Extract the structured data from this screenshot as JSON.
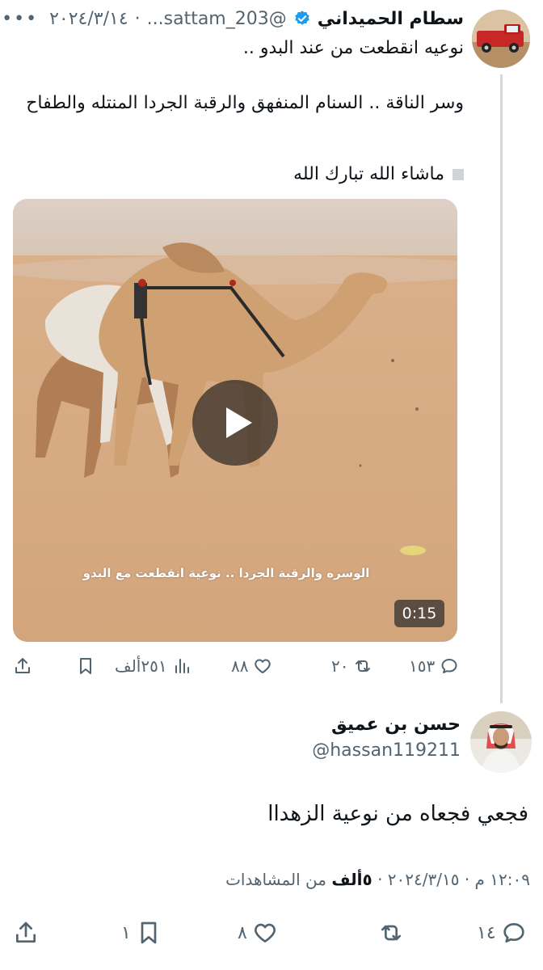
{
  "quoted_tweet": {
    "author_name": "سطام الحميداني",
    "handle": "@sattam_203...",
    "date": "٢٠٢٤/٣/١٤",
    "more_label": "•••",
    "line1": "نوعيه انقطعت من عند البدو ..",
    "line2": "وسر الناقة ..  السنام المنفهق والرقبة الجردا المنتله والطفاح",
    "line3": "ماشاء الله تبارك الله",
    "video": {
      "caption": "الوسره والرقبة الجردا .. نوعية انقطعت مع البدو",
      "duration": "0:15"
    },
    "actions": {
      "replies": "١٥٣",
      "retweets": "٢٠",
      "likes": "٨٨",
      "views": "٢٥١ألف"
    },
    "colors": {
      "verified": "#1d9bf0",
      "muted": "#536471",
      "thread_line": "#cfd9de"
    }
  },
  "main_tweet": {
    "author_name": "حسن بن عميق",
    "handle": "@hassan119211",
    "body": "فجعي فجعاه من نوعية الزهداا",
    "timestamp": "١٢:٠٩ م · ٢٠٢٤/٣/١٥",
    "views_count": "٥ألف",
    "views_label": "من المشاهدات",
    "actions": {
      "replies": "١٤",
      "retweets": "",
      "likes": "٨",
      "bookmarks": "١"
    }
  }
}
